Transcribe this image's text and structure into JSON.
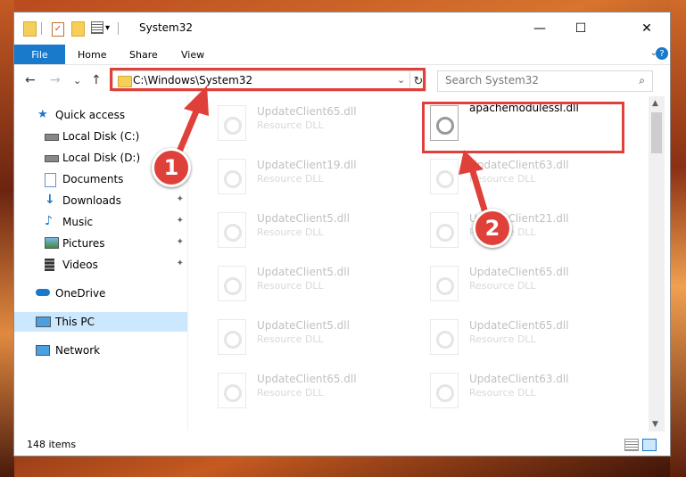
{
  "window": {
    "title": "System32"
  },
  "titlebar": {
    "minimize": "—",
    "maximize": "☐",
    "close": "✕",
    "qa_dropdown": "▾"
  },
  "ribbon": {
    "tabs": [
      {
        "label": "File"
      },
      {
        "label": "Home"
      },
      {
        "label": "Share"
      },
      {
        "label": "View"
      }
    ],
    "expand_caret": "⌄",
    "help": "?"
  },
  "nav": {
    "back": "←",
    "forward": "→",
    "recent": "⌄",
    "up": "↑"
  },
  "address": {
    "path": "C:\\Windows\\System32",
    "dropdown": "⌄",
    "refresh": "↻"
  },
  "search": {
    "placeholder": "Search System32",
    "icon": "search-icon"
  },
  "sidebar": {
    "items": [
      {
        "label": "Quick access",
        "icon": "star-icon"
      },
      {
        "label": "Local Disk (C:)",
        "icon": "drive-icon"
      },
      {
        "label": "Local Disk (D:)",
        "icon": "drive-icon"
      },
      {
        "label": "Documents",
        "icon": "documents-icon"
      },
      {
        "label": "Downloads",
        "icon": "download-icon"
      },
      {
        "label": "Music",
        "icon": "music-icon"
      },
      {
        "label": "Pictures",
        "icon": "pictures-icon"
      },
      {
        "label": "Videos",
        "icon": "videos-icon"
      },
      {
        "label": "OneDrive",
        "icon": "cloud-icon"
      },
      {
        "label": "This PC",
        "icon": "computer-icon"
      },
      {
        "label": "Network",
        "icon": "network-icon"
      }
    ],
    "pin": "📌"
  },
  "files": {
    "highlighted": {
      "name": "apachemodulessl.dll"
    },
    "left": [
      {
        "name": "UpdateClient65.dll",
        "type": "Resource DLL"
      },
      {
        "name": "UpdateClient19.dll",
        "type": "Resource DLL"
      },
      {
        "name": "UpdateClient5.dll",
        "type": "Resource DLL"
      },
      {
        "name": "UpdateClient5.dll",
        "type": "Resource DLL"
      },
      {
        "name": "UpdateClient5.dll",
        "type": "Resource DLL"
      },
      {
        "name": "UpdateClient65.dll",
        "type": "Resource DLL"
      }
    ],
    "right": [
      {
        "name": "UpdateClient63.dll",
        "type": "Resource DLL"
      },
      {
        "name": "UpdateClient21.dll",
        "type": "Resource DLL"
      },
      {
        "name": "UpdateClient65.dll",
        "type": "Resource DLL"
      },
      {
        "name": "UpdateClient65.dll",
        "type": "Resource DLL"
      },
      {
        "name": "UpdateClient63.dll",
        "type": "Resource DLL"
      }
    ]
  },
  "status": {
    "count": "148 items"
  },
  "scroll": {
    "up": "▲",
    "down": "▼"
  },
  "annotations": {
    "step1": "1",
    "step2": "2",
    "color": "#e0403a"
  }
}
